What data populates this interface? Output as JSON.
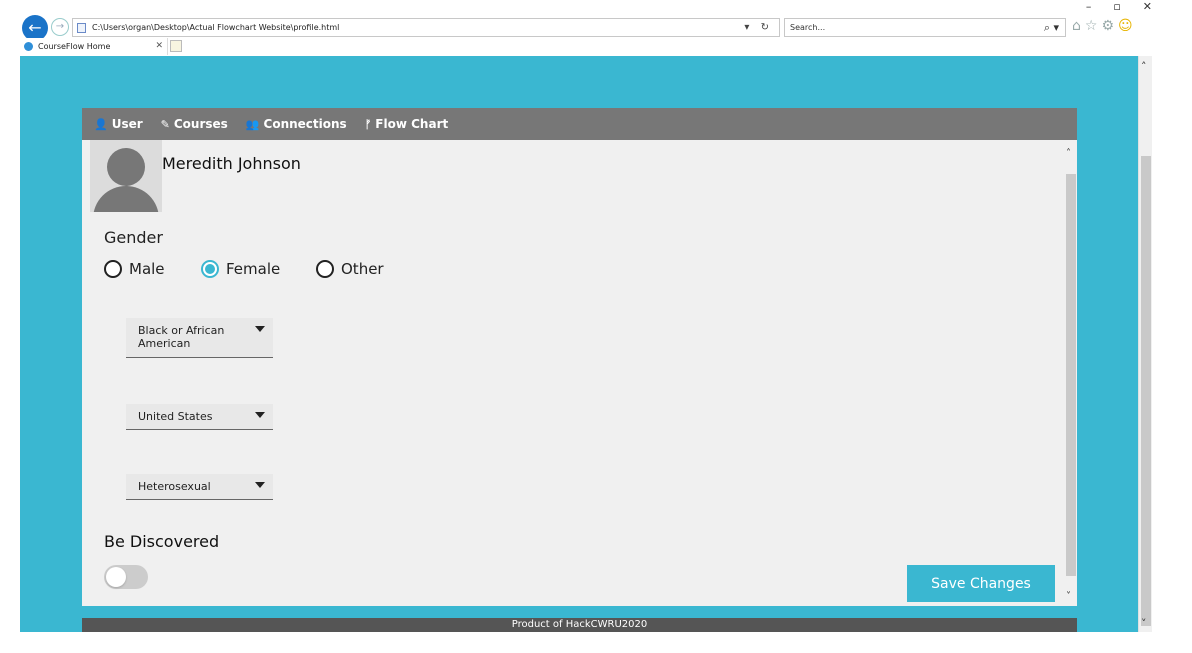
{
  "window": {
    "minimize": "–",
    "restore": "▫",
    "close": "✕"
  },
  "browser": {
    "address": "C:\\Users\\organ\\Desktop\\Actual Flowchart Website\\profile.html",
    "address_tools": "▾ ↻",
    "search_placeholder": "Search...",
    "search_tools": "⌕ ▾",
    "tab_title": "CourseFlow Home",
    "tab_close": "✕",
    "icons": [
      "home-icon",
      "star-icon",
      "gear-icon",
      "smiley-icon"
    ]
  },
  "nav": {
    "items": [
      {
        "label": "User",
        "icon": "user-icon",
        "glyph": "👤"
      },
      {
        "label": "Courses",
        "icon": "pencil-icon",
        "glyph": "✎"
      },
      {
        "label": "Connections",
        "icon": "users-icon",
        "glyph": "👥"
      },
      {
        "label": "Flow Chart",
        "icon": "flow-icon",
        "glyph": "ᚠ"
      }
    ]
  },
  "profile": {
    "name": "Meredith Johnson"
  },
  "gender": {
    "title": "Gender",
    "options": [
      {
        "label": "Male",
        "checked": false
      },
      {
        "label": "Female",
        "checked": true
      },
      {
        "label": "Other",
        "checked": false
      }
    ]
  },
  "selects": {
    "race": "Black or African American",
    "country": "United States",
    "orientation": "Heterosexual"
  },
  "discover": {
    "title": "Be Discovered",
    "enabled": false
  },
  "save_label": "Save Changes",
  "footer": "Product of HackCWRU2020",
  "colors": {
    "accent": "#3ab7d1",
    "navbar": "#777777",
    "footer": "#555555",
    "card": "#f0f0f0"
  }
}
